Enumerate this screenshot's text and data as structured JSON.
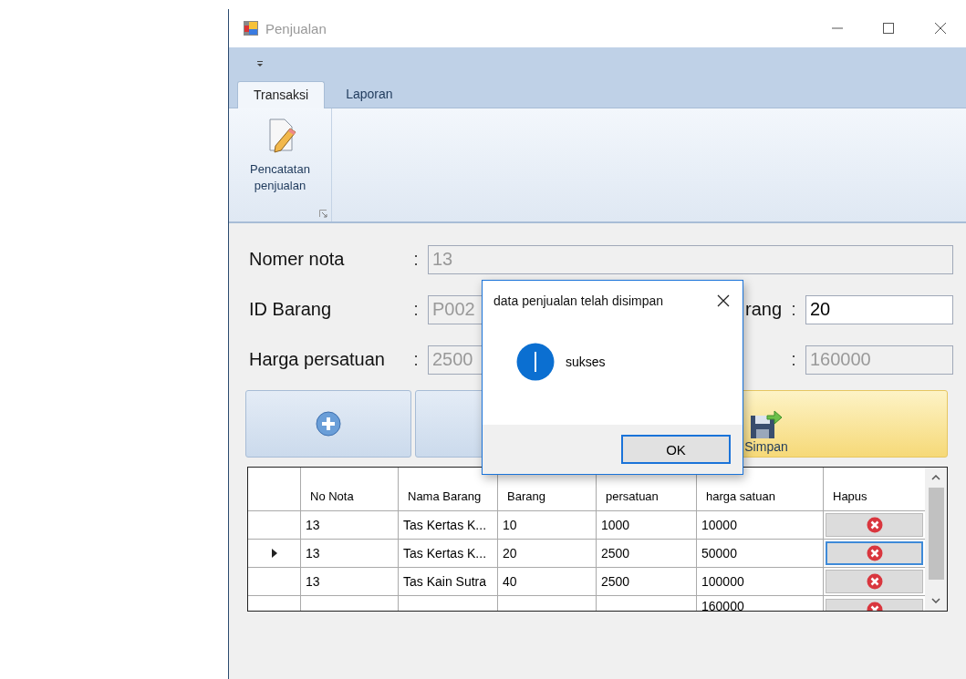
{
  "window": {
    "title": "Penjualan"
  },
  "ribbon": {
    "tabs": [
      {
        "label": "Transaksi",
        "selected": true
      },
      {
        "label": "Laporan",
        "selected": false
      }
    ],
    "group_button": "Pencatatan penjualan"
  },
  "form": {
    "rows": [
      {
        "label": "Nomer nota",
        "colon": ":",
        "value": "13",
        "disabled": true
      },
      {
        "label": "ID Barang",
        "colon": ":",
        "value": "P002",
        "disabled": true,
        "right_label": "rang",
        "right_colon": ":",
        "right_value": "20",
        "right_disabled": false
      },
      {
        "label": "Harga persatuan",
        "colon": ":",
        "value": "2500",
        "disabled": true,
        "right_colon": ":",
        "right_value": "160000",
        "right_disabled": true
      }
    ]
  },
  "buttons": [
    {
      "kind": "add",
      "highlighted": false
    },
    {
      "kind": "blank",
      "highlighted": false
    },
    {
      "kind": "save",
      "label": "Simpan",
      "highlighted": true
    }
  ],
  "table": {
    "columns": [
      "No Nota",
      "Nama Barang",
      "Barang",
      "persatuan",
      "harga satuan",
      "Hapus"
    ],
    "rows": [
      {
        "current": false,
        "cells": [
          "13",
          "Tas Kertas K...",
          "10",
          "1000",
          "10000"
        ]
      },
      {
        "current": true,
        "cells": [
          "13",
          "Tas Kertas K...",
          "20",
          "2500",
          "50000"
        ]
      },
      {
        "current": false,
        "cells": [
          "13",
          "Tas Kain Sutra",
          "40",
          "2500",
          "100000"
        ]
      },
      {
        "current": false,
        "cells": [
          "",
          "",
          "",
          "",
          "160000"
        ]
      }
    ]
  },
  "dialog": {
    "title": "data penjualan telah disimpan",
    "message": "sukses",
    "button": "OK"
  }
}
